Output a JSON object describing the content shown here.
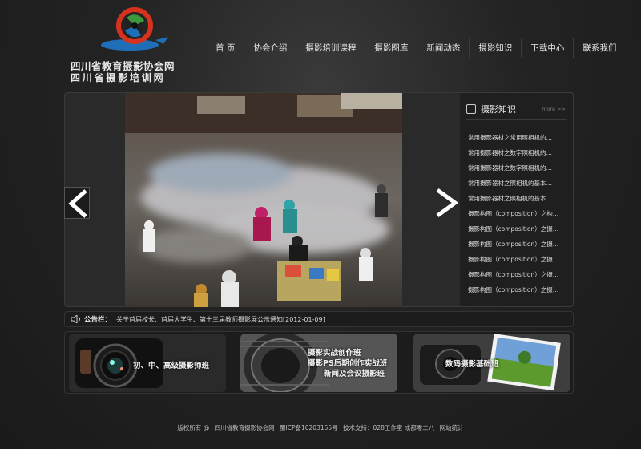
{
  "logo": {
    "line1": "四川省教育摄影协会网",
    "line2": "四川省摄影培训网"
  },
  "nav": [
    {
      "label": "首  页"
    },
    {
      "label": "协会介绍"
    },
    {
      "label": "摄影培训课程"
    },
    {
      "label": "摄影图库"
    },
    {
      "label": "新闻动态"
    },
    {
      "label": "摄影知识"
    },
    {
      "label": "下载中心"
    },
    {
      "label": "联系我们"
    }
  ],
  "knowledge": {
    "title": "摄影知识",
    "more": "more >>",
    "items": [
      "常用摄影器材之常用照相机的…",
      "常用摄影器材之数字照相机的…",
      "常用摄影器材之数字照相机的…",
      "常用摄影器材之照相机的基本…",
      "常用摄影器材之照相机的基本…",
      "摄影构图（composition）之构…",
      "摄影构图（composition）之摄…",
      "摄影构图（composition）之摄…",
      "摄影构图（composition）之摄…",
      "摄影构图（composition）之摄…",
      "摄影构图（composition）之摄…"
    ]
  },
  "notice": {
    "label": "公告栏：",
    "text": "关于首届校长、首届大学生、第十三届教师摄影展公示通知[2012-01-09]"
  },
  "cards": [
    {
      "lines": [
        "初、中、高级摄影师班"
      ]
    },
    {
      "lines": [
        "摄影实战创作班",
        "摄影PS后期创作实战班",
        "新闻及会议摄影班"
      ]
    },
    {
      "lines": [
        "数码摄影基础班"
      ]
    }
  ],
  "footer": {
    "copyright": "版权所有 @",
    "site": "四川省教育摄影协会网",
    "icp": "蜀ICP备10203155号",
    "support": "技术支持：028工作室 成都零二八",
    "stats": "网站统计"
  },
  "colors": {
    "background": "#232323",
    "panel": "#1f1f1f",
    "text": "#e6e6e6",
    "logo_red": "#d6321e",
    "logo_blue": "#1f6fb8",
    "logo_green": "#3c9a3c"
  }
}
